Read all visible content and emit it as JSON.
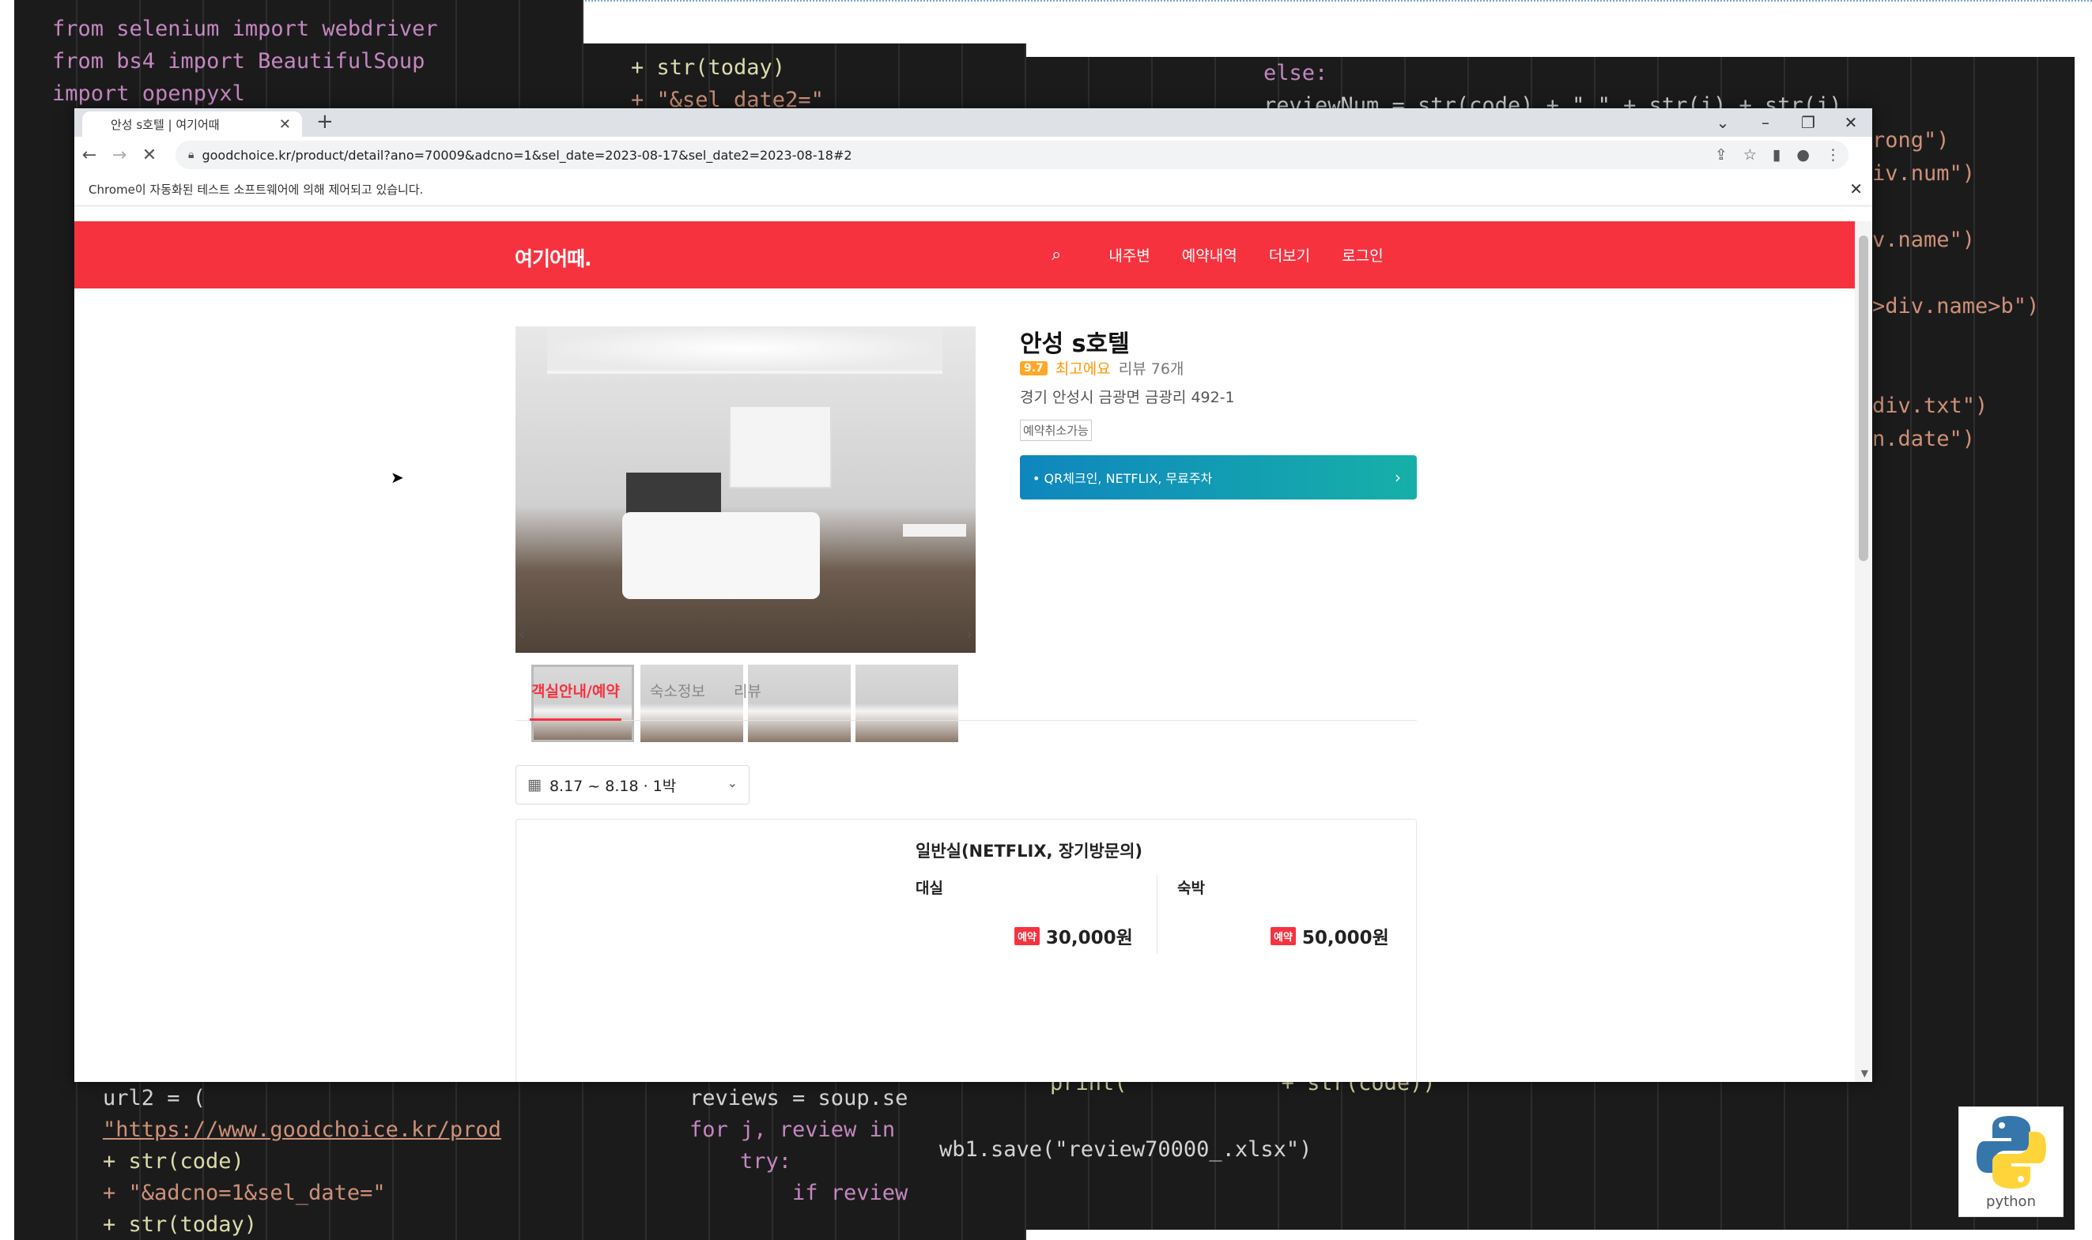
{
  "background": {
    "code_left": [
      "from selenium import webdriver",
      "from bs4 import BeautifulSoup",
      "import openpyxl"
    ],
    "code_mid": [
      "+ str(today)",
      "+ \"&sel_date2=\""
    ],
    "code_right": [
      "else:",
      "reviewNum = str(code) + \"_\" + str(i) + str(j)",
      "rong\")",
      "iv.num\")",
      "v.name\")",
      ">div.name>b\")",
      "div.txt\")",
      "n.date\")"
    ],
    "code_bottom_left": [
      "url2 = (",
      "\"https://www.goodchoice.kr/prod",
      "+ str(code)",
      "+ \"&adcno=1&sel_date=\"",
      "+ str(today)"
    ],
    "code_bottom_mid": [
      "reviews = soup.se",
      "for j, review in",
      "try:",
      "if review"
    ],
    "code_bottom_right": [
      "print(",
      "+ str(code))",
      "wb1.save(\"review70000_.xlsx\")"
    ]
  },
  "python_logo": {
    "label": "python"
  },
  "browser": {
    "tab_title": "안성 s호텔 | 여기어때",
    "new_tab_label": "+",
    "url": "goodchoice.kr/product/detail?ano=70009&adcno=1&sel_date=2023-08-17&sel_date2=2023-08-18#2",
    "infobar_text": "Chrome이 자동화된 테스트 소프트웨어에 의해 제어되고 있습니다."
  },
  "site": {
    "logo": "여기어때.",
    "nav": [
      "내주변",
      "예약내역",
      "더보기",
      "로그인"
    ]
  },
  "hotel": {
    "name": "안성 s호텔",
    "score": "9.7",
    "rating_text": "최고에요",
    "review_count": "리뷰 76개",
    "address": "경기 안성시 금광면 금광리 492-1",
    "cancel_badge": "예약취소가능",
    "promo": "• QR체크인, NETFLIX, 무료주차"
  },
  "page_tabs": [
    "객실안내/예약",
    "숙소정보",
    "리뷰"
  ],
  "date_picker": {
    "value": "8.17 ~ 8.18 · 1박"
  },
  "room": {
    "name": "일반실(NETFLIX, 장기방문의)",
    "rent_label": "대실",
    "stay_label": "숙박",
    "badge": "예약",
    "rent_price": "30,000원",
    "stay_price": "50,000원"
  },
  "colors": {
    "brand": "#f7323f",
    "promo_start": "#0f86bf",
    "promo_end": "#16b0a8",
    "rating": "#ffa726"
  }
}
